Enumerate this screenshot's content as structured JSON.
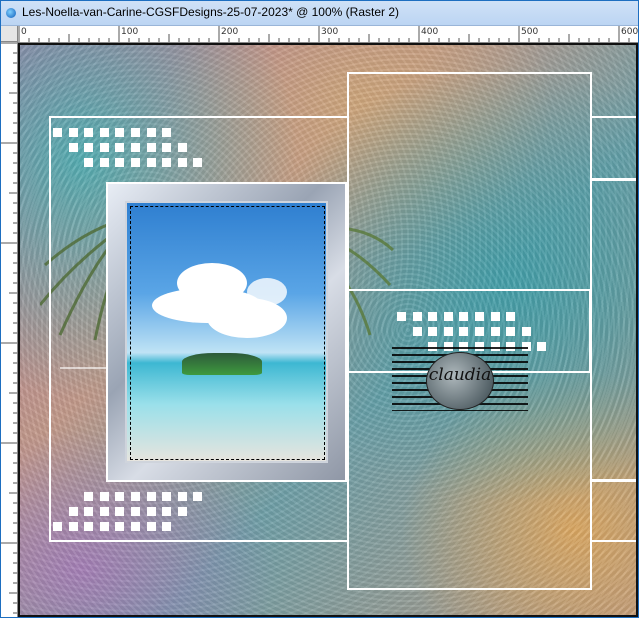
{
  "window": {
    "title": "Les-Noella-van-Carine-CGSFDesigns-25-07-2023* @ 100% (Raster 2)",
    "icon": "psp-app-icon"
  },
  "ruler": {
    "labels": [
      "0",
      "100",
      "200",
      "300",
      "400",
      "500",
      "600"
    ]
  },
  "canvas": {
    "watermark_text": "claudia"
  },
  "colors": {
    "title_bar": "#c6dbf5",
    "frame_border": "#ffffff",
    "canvas_border": "#111111"
  }
}
